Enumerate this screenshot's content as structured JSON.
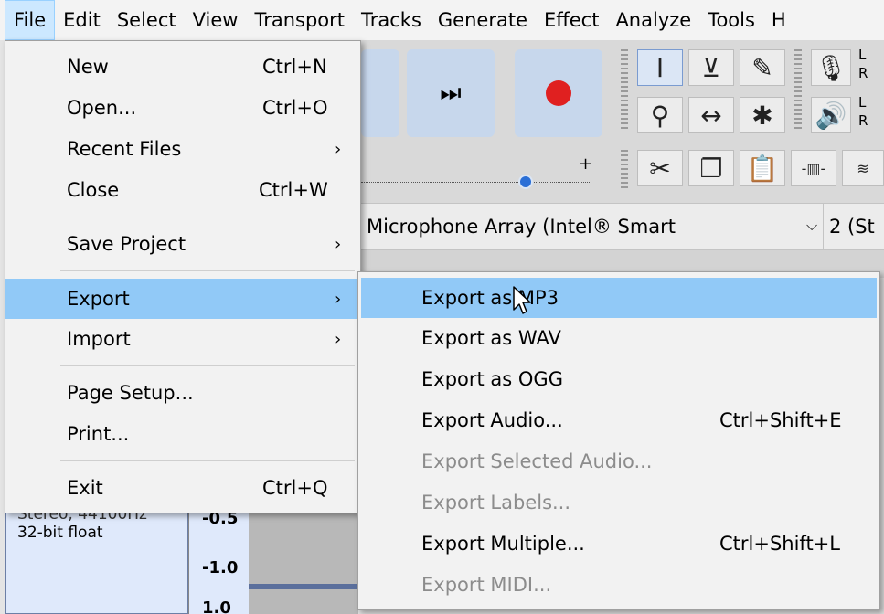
{
  "menubar": {
    "items": [
      "File",
      "Edit",
      "Select",
      "View",
      "Transport",
      "Tracks",
      "Generate",
      "Effect",
      "Analyze",
      "Tools",
      "H"
    ],
    "active_index": 0
  },
  "file_menu": {
    "items": [
      {
        "label": "New",
        "shortcut": "Ctrl+N"
      },
      {
        "label": "Open...",
        "shortcut": "Ctrl+O"
      },
      {
        "label": "Recent Files",
        "submenu": true
      },
      {
        "label": "Close",
        "shortcut": "Ctrl+W"
      },
      {
        "label": "Save Project",
        "submenu": true
      },
      {
        "label": "Export",
        "submenu": true,
        "highlighted": true
      },
      {
        "label": "Import",
        "submenu": true
      },
      {
        "label": "Page Setup..."
      },
      {
        "label": "Print..."
      },
      {
        "label": "Exit",
        "shortcut": "Ctrl+Q"
      }
    ]
  },
  "export_submenu": {
    "items": [
      {
        "label": "Export as MP3",
        "highlighted": true
      },
      {
        "label": "Export as WAV"
      },
      {
        "label": "Export as OGG"
      },
      {
        "label": "Export Audio...",
        "shortcut": "Ctrl+Shift+E"
      },
      {
        "label": "Export Selected Audio...",
        "disabled": true
      },
      {
        "label": "Export Labels...",
        "disabled": true
      },
      {
        "label": "Export Multiple...",
        "shortcut": "Ctrl+Shift+L"
      },
      {
        "label": "Export MIDI...",
        "disabled": true
      }
    ]
  },
  "device_toolbar": {
    "input_device": "Microphone Array (Intel® Smart",
    "channels": "2 (St"
  },
  "track": {
    "format_line1": "Stereo, 44100Hz",
    "format_line2": "32-bit float",
    "scale": [
      "-0.5",
      "-1.0",
      "1.0"
    ]
  },
  "meter_letters": {
    "left": "L",
    "right": "R"
  },
  "colors": {
    "menu_highlight": "#91c9f7",
    "record": "#e02020",
    "menubar_active": "#cce8ff"
  },
  "icons": {
    "skip_end": "⏭",
    "record": "●",
    "ibeam": "I",
    "envelope": "envelope-tool",
    "draw": "pencil",
    "mic": "microphone",
    "zoom": "magnifier",
    "timeshift": "↔",
    "multi": "✱",
    "speaker": "speaker",
    "cut": "✂",
    "copy": "copy",
    "paste": "paste"
  }
}
